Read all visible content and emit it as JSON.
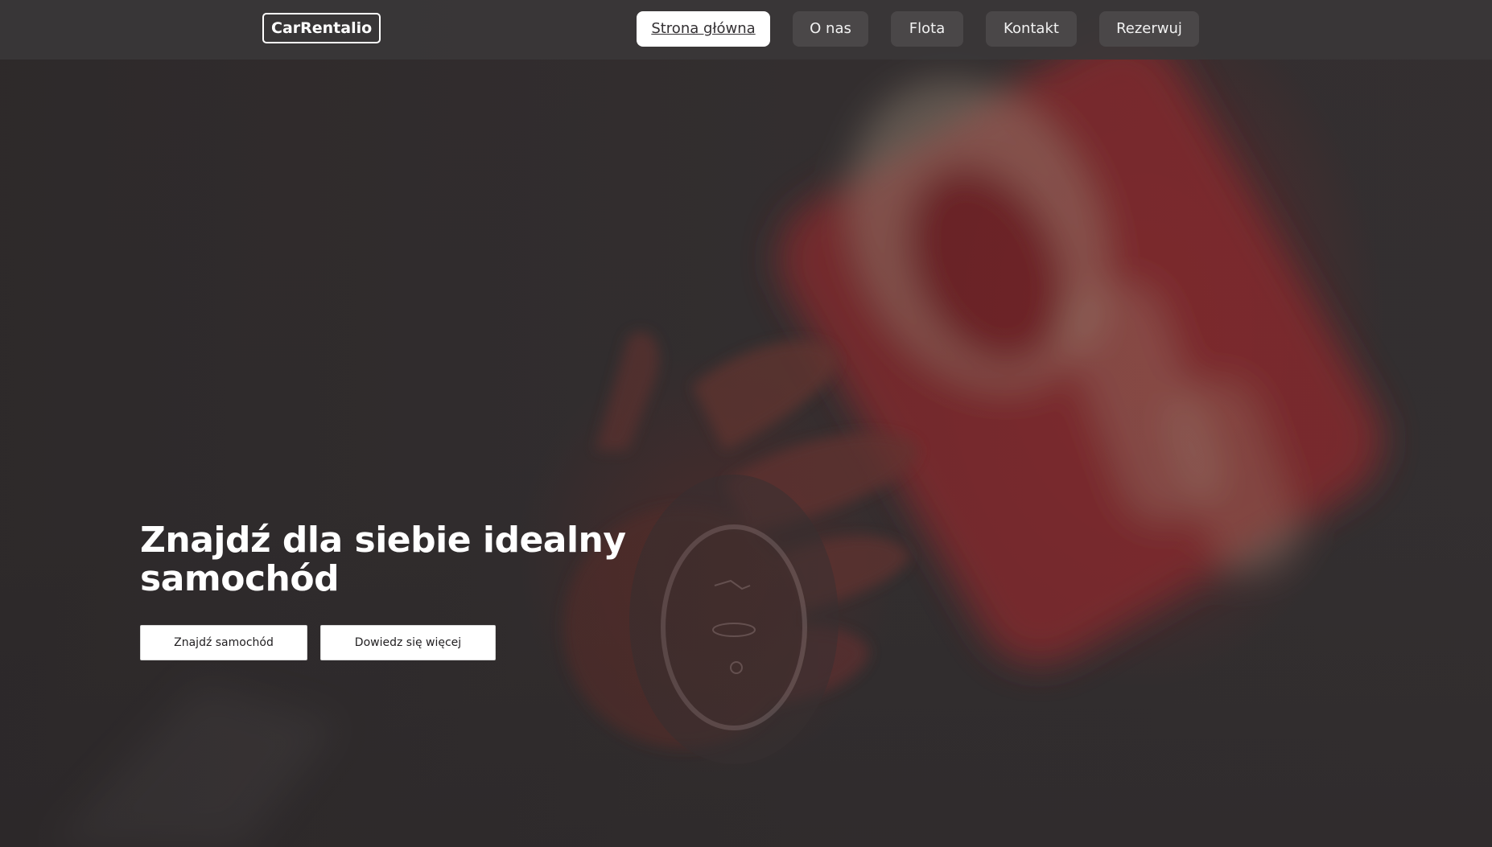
{
  "brand": {
    "logo_text": "CarRentalio"
  },
  "nav": {
    "items": [
      {
        "label": "Strona główna",
        "active": true
      },
      {
        "label": "O nas",
        "active": false
      },
      {
        "label": "Flota",
        "active": false
      },
      {
        "label": "Kontakt",
        "active": false
      },
      {
        "label": "Rezerwuj",
        "active": false
      }
    ]
  },
  "hero": {
    "title": "Znajdź dla siebie idealny samochód",
    "primary_button": "Znajdź samochód",
    "secondary_button": "Dowiedz się więcej",
    "background_icon": "hand-holding-car-key-image"
  },
  "colors": {
    "navbar_bg": "#3a3738",
    "nav_pill_bg": "#4a4748",
    "active_pill_bg": "#ffffff",
    "hero_bg": "#343031",
    "accent_red": "#962328"
  }
}
